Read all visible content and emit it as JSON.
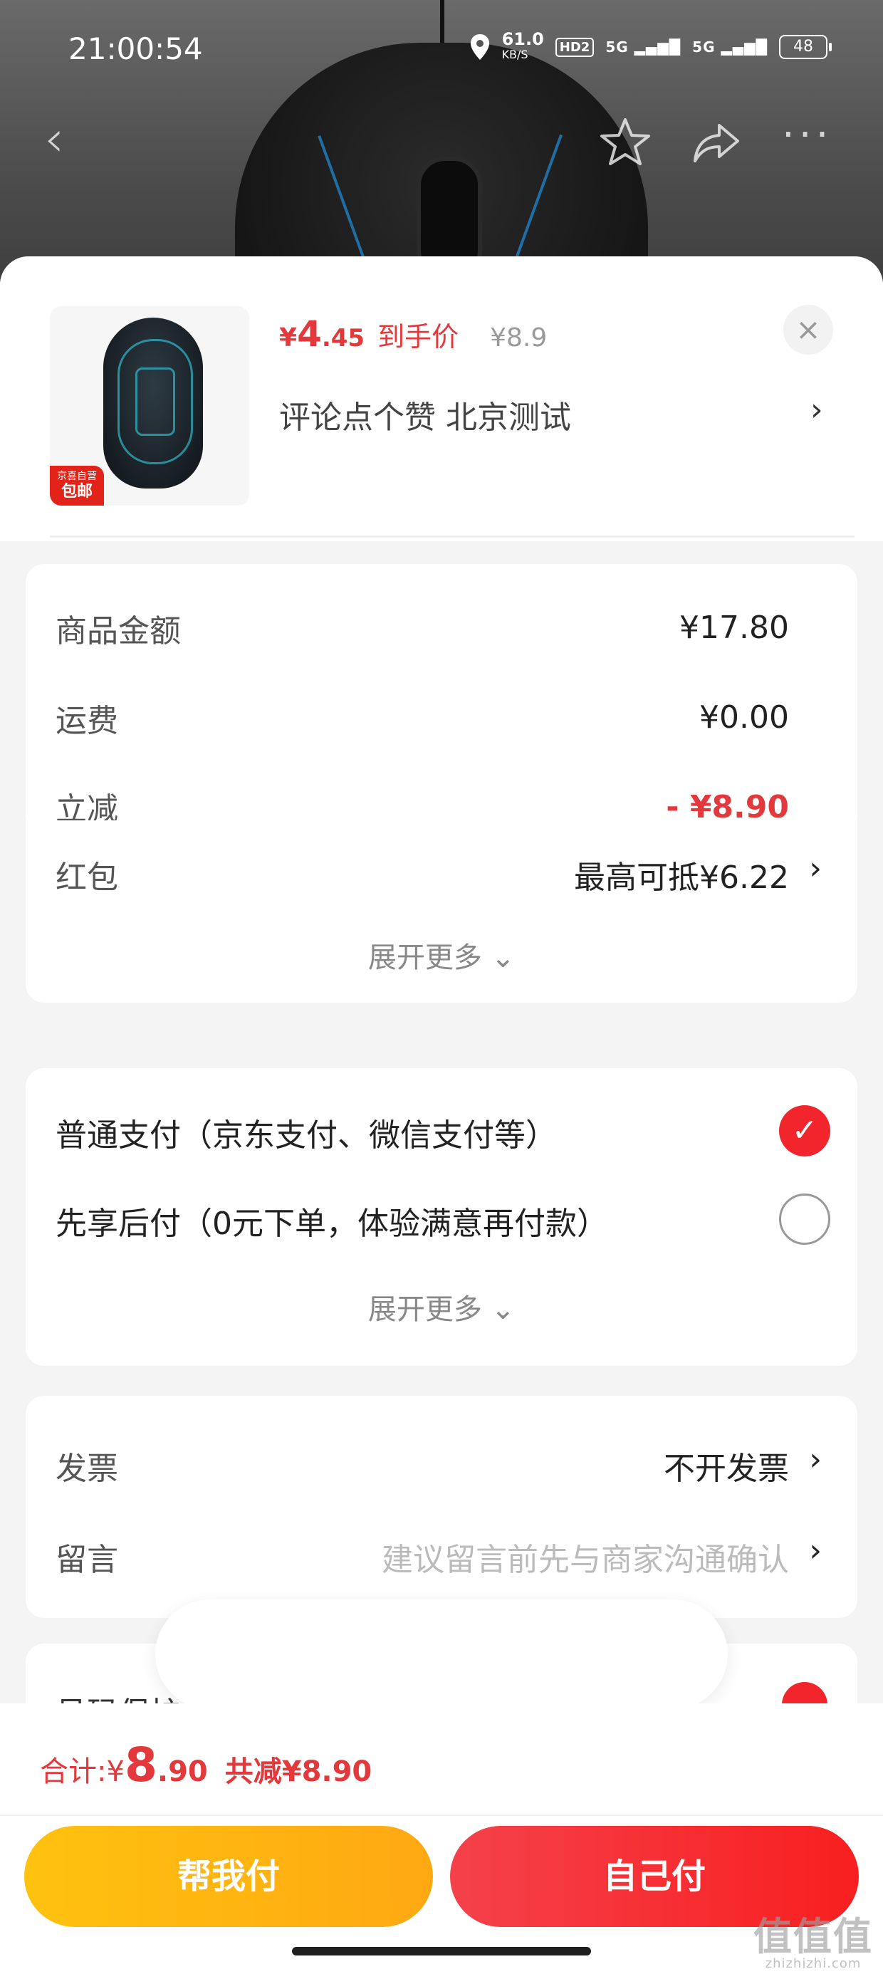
{
  "status_bar": {
    "time": "21:00:54",
    "net_speed": "61.0",
    "net_unit": "KB/S",
    "hd": "HD2",
    "signal1": "5G",
    "signal2": "5G",
    "battery": "48"
  },
  "product": {
    "price_currency": "¥",
    "price_int": "4",
    "price_dec": ".45",
    "price_tag": "到手价",
    "original_price": "¥8.9",
    "title": "评论点个赞  北京测试",
    "badge_top": "京喜自营",
    "badge_bottom": "包邮"
  },
  "amounts": {
    "rows": [
      {
        "label": "商品金额",
        "value": "¥17.80"
      },
      {
        "label": "运费",
        "value": "¥0.00"
      },
      {
        "label": "立减",
        "value": "- ¥8.90"
      },
      {
        "label": "红包",
        "value": "最高可抵¥6.22"
      }
    ],
    "expand": "展开更多 ⌄"
  },
  "payment": {
    "options": [
      {
        "label": "普通支付（京东支付、微信支付等）",
        "selected": true
      },
      {
        "label": "先享后付（0元下单，体验满意再付款）",
        "selected": false
      }
    ],
    "expand": "展开更多 ⌄"
  },
  "extras": {
    "invoice_label": "发票",
    "invoice_value": "不开发票",
    "note_label": "留言",
    "note_placeholder": "建议留言前先与商家沟通确认"
  },
  "peek": {
    "label": "号码保护（隐藏收件人真实号码）"
  },
  "footer": {
    "total_label": "合计: ",
    "total_currency": "¥",
    "total_int": "8",
    "total_dec": ".90",
    "total_save": "共减¥8.90",
    "help_pay": "帮我付",
    "self_pay": "自己付"
  },
  "watermark": {
    "text": "值值值",
    "url": "zhizhizhi.com"
  },
  "colors": {
    "accent_red": "#e4393c",
    "button_yellow": "#ffb20f",
    "button_red": "#f81f1f"
  }
}
